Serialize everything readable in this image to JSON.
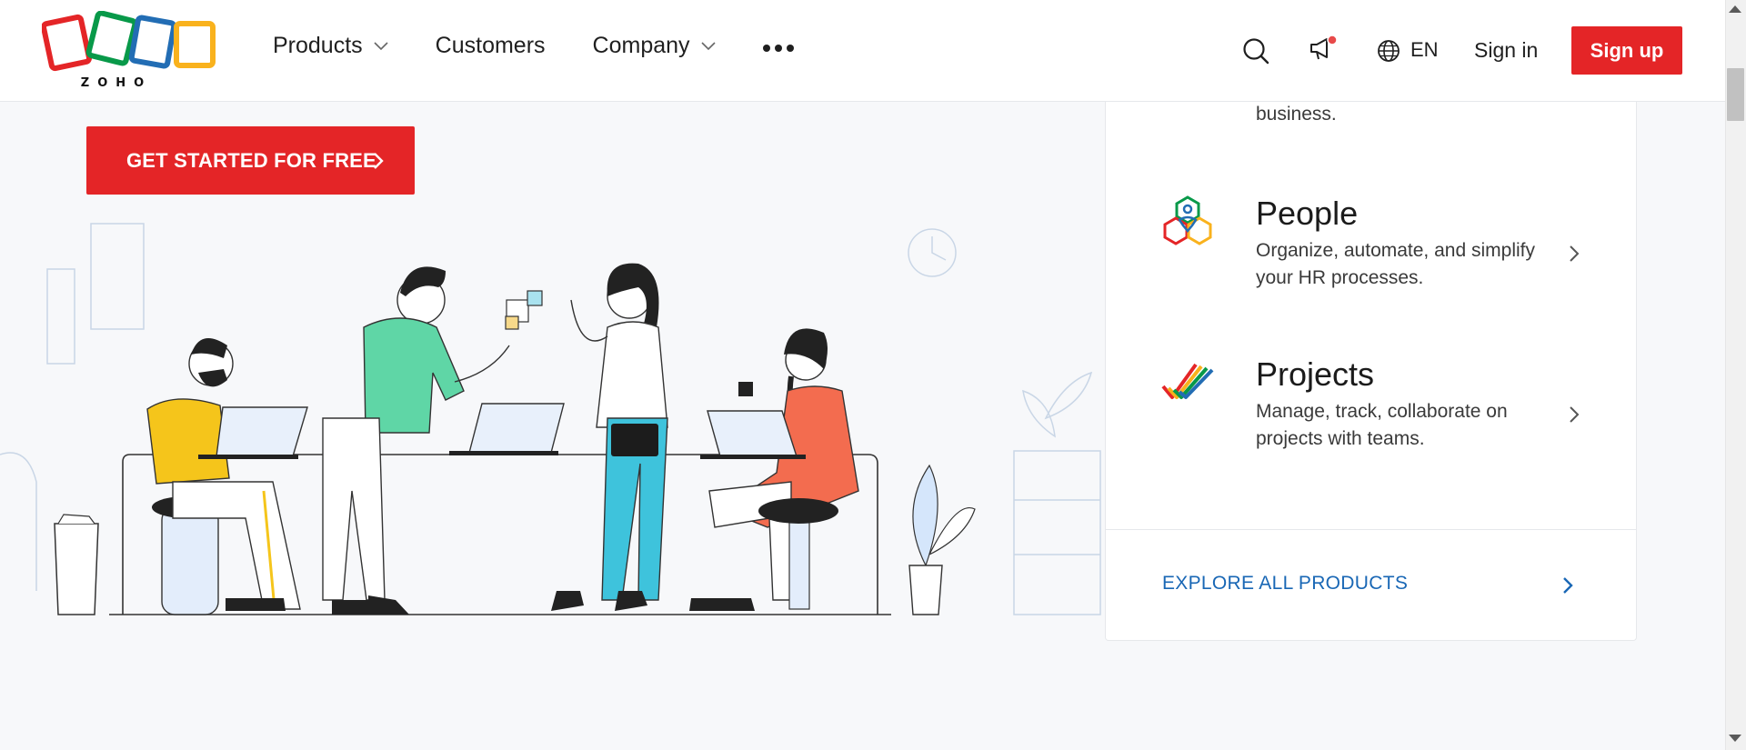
{
  "brand": {
    "name": "ZOHO",
    "colors": {
      "red": "#e42527",
      "green": "#089949",
      "blue": "#226db4",
      "yellow": "#f9b21d"
    }
  },
  "nav": {
    "items": [
      {
        "label": "Products",
        "has_dropdown": true
      },
      {
        "label": "Customers",
        "has_dropdown": false
      },
      {
        "label": "Company",
        "has_dropdown": true
      }
    ],
    "more_icon": "ellipsis-icon"
  },
  "header": {
    "search_icon": "search-icon",
    "announce_icon": "megaphone-icon",
    "language": "EN",
    "signin_label": "Sign in",
    "signup_label": "Sign up"
  },
  "hero": {
    "cta_label": "GET STARTED FOR FREE"
  },
  "products": {
    "previous_desc_tail": "business.",
    "items": [
      {
        "name": "People",
        "desc": "Organize, automate, and simplify your HR processes.",
        "icon": "people-hexagon-icon"
      },
      {
        "name": "Projects",
        "desc": "Manage, track, collaborate on projects with teams.",
        "icon": "projects-check-icon"
      }
    ],
    "explore_label": "EXPLORE ALL PRODUCTS"
  }
}
